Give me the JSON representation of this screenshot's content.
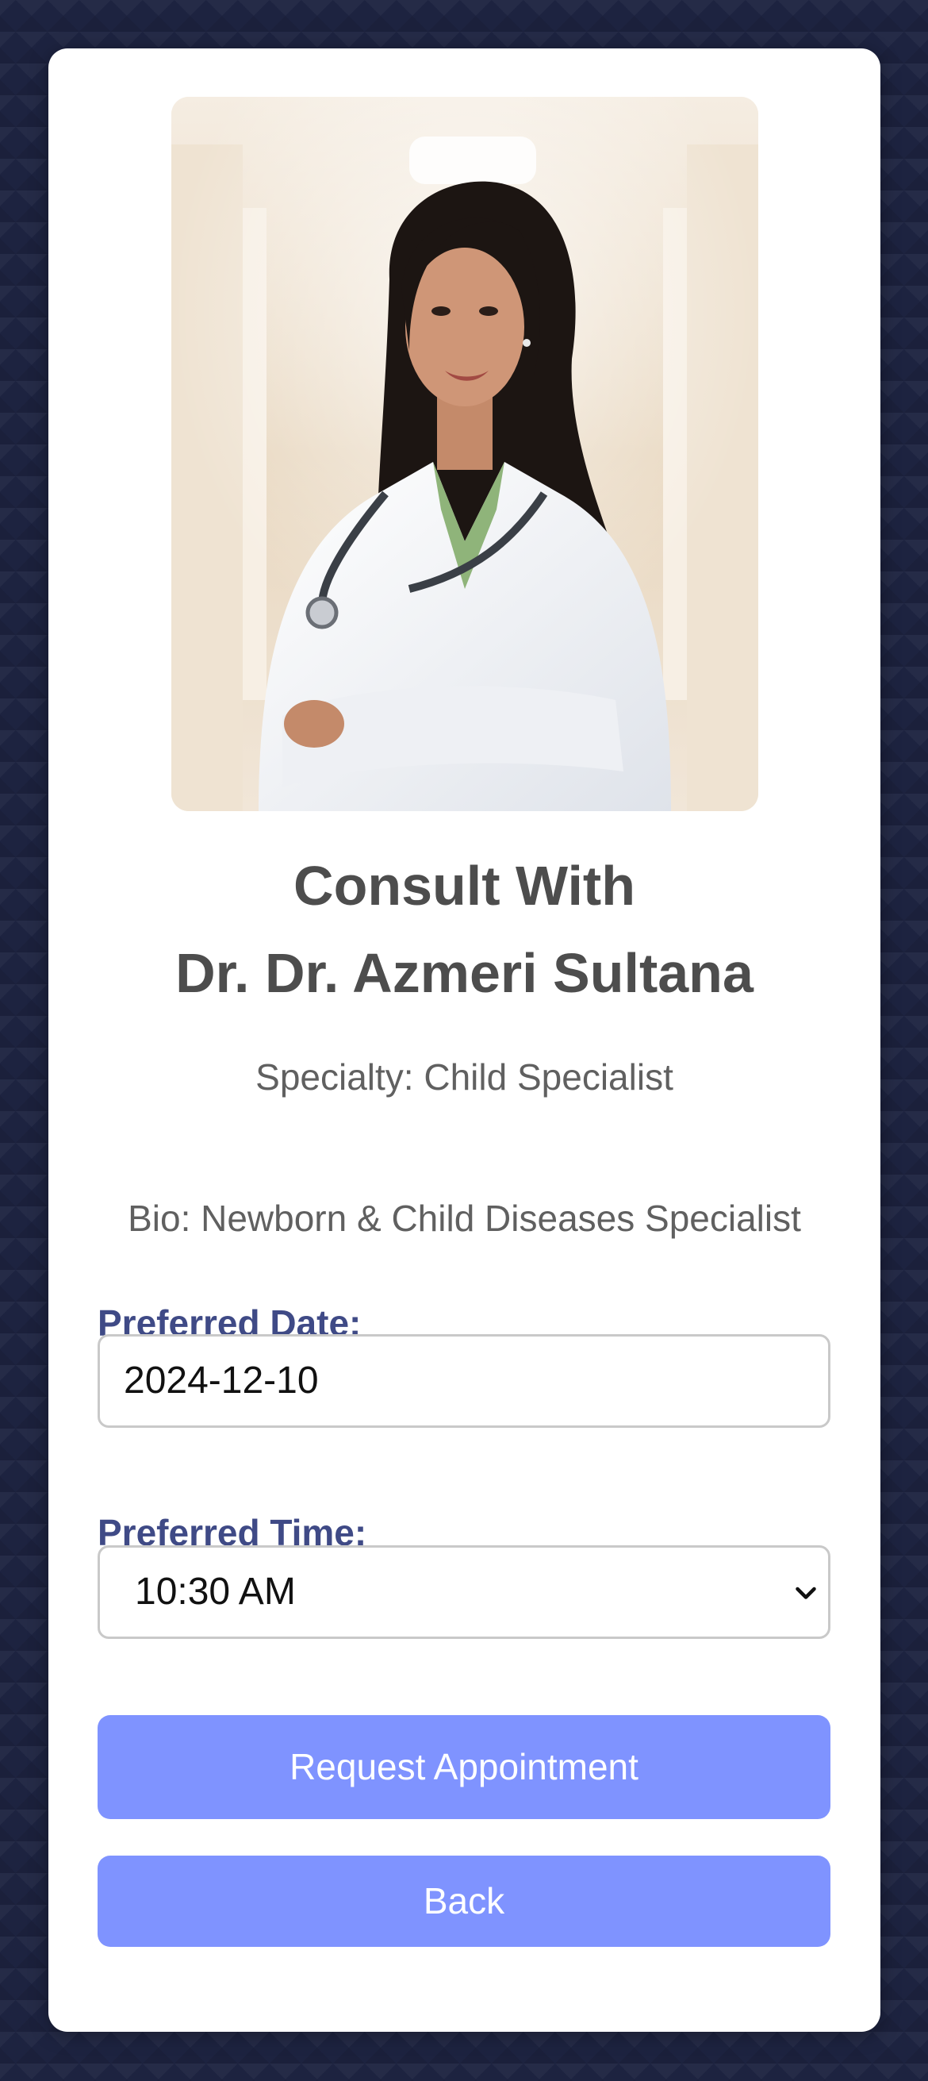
{
  "doctor": {
    "title_line1": "Consult With",
    "title_line2": "Dr. Dr. Azmeri Sultana",
    "specialty": "Specialty: Child Specialist",
    "bio": "Bio: Newborn & Child Diseases Specialist"
  },
  "form": {
    "date_label": "Preferred Date:",
    "date_value": "2024-12-10",
    "time_label": "Preferred Time:",
    "time_value": "10:30 AM"
  },
  "buttons": {
    "request_label": "Request Appointment",
    "back_label": "Back"
  },
  "colors": {
    "background": "#1d2340",
    "button": "#7f93ff",
    "label": "#3f4a86"
  },
  "icons": {
    "select_arrow": "chevron-down-icon"
  }
}
